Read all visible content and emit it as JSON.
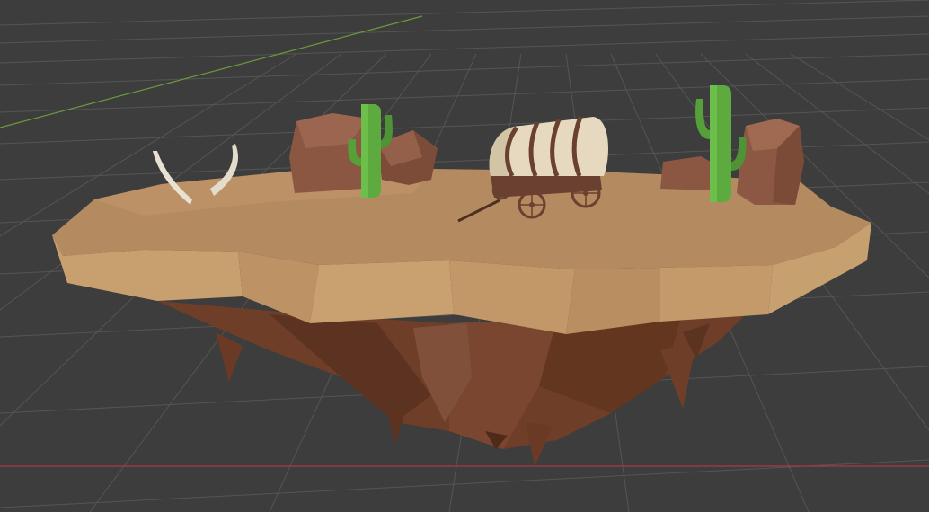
{
  "viewport": {
    "background": "#3d3d3d",
    "grid_color": "#555555",
    "x_axis_color": "#a83a45",
    "y_axis_color": "#6a9a3a"
  },
  "scene": {
    "objects": [
      "floating-island",
      "covered-wagon",
      "cactus-left",
      "cactus-right",
      "rock-left",
      "rock-right",
      "horn-left",
      "horn-right"
    ],
    "colors": {
      "sand_top": "#b48a60",
      "sand_side": "#c29b6c",
      "dirt": "#6e3e28",
      "rock": "#8b5742",
      "cactus": "#5dab3e",
      "wagon_cover": "#e6d9c0",
      "wagon_wood": "#6a4030",
      "bone": "#e9e2d2"
    }
  }
}
